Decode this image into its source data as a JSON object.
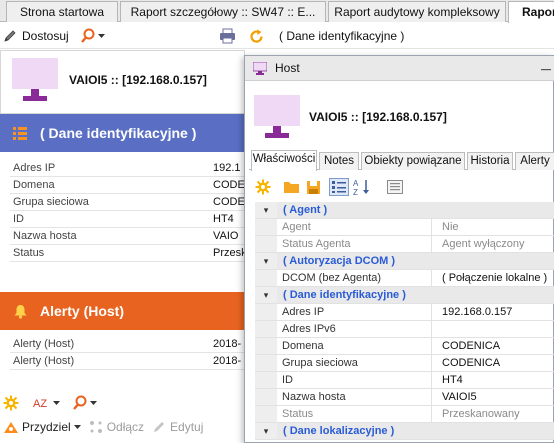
{
  "tabs": [
    {
      "label": "Strona startowa"
    },
    {
      "label": "Raport szczegółowy  ::  SW47 :: E..."
    },
    {
      "label": "Raport audytowy kompleksowy"
    },
    {
      "label": "Raport"
    }
  ],
  "toolbar": {
    "adjust_label": "Dostosuj",
    "section_label": "( Dane identyfikacyjne )"
  },
  "left": {
    "host_title": "VAIOI5 :: [192.168.0.157]",
    "identity_title": "( Dane identyfikacyjne )",
    "identity_rows": [
      {
        "key": "Adres IP",
        "value": "192.1"
      },
      {
        "key": "Domena",
        "value": "CODE"
      },
      {
        "key": "Grupa sieciowa",
        "value": "CODE"
      },
      {
        "key": "ID",
        "value": "HT4"
      },
      {
        "key": "Nazwa hosta",
        "value": "VAIO"
      },
      {
        "key": "Status",
        "value": "Przesk"
      }
    ],
    "alerts_title": "Alerty (Host)",
    "alert_rows": [
      {
        "key": "Alerty (Host)",
        "value": "2018-"
      },
      {
        "key": "Alerty (Host)",
        "value": "2018-"
      }
    ],
    "assign_label": "Przydziel",
    "detach_label": "Odłącz",
    "edit_label": "Edytuj"
  },
  "window": {
    "title": "Host",
    "host_title": "VAIOI5 :: [192.168.0.157]",
    "tabs": [
      {
        "label": "Właściwości"
      },
      {
        "label": "Notes"
      },
      {
        "label": "Obiekty powiązane"
      },
      {
        "label": "Historia"
      },
      {
        "label": "Alerty"
      }
    ],
    "rows": [
      {
        "type": "cat",
        "label": "( Agent )"
      },
      {
        "type": "prop",
        "dim": true,
        "key": "Agent",
        "value": "Nie"
      },
      {
        "type": "prop",
        "dim": true,
        "key": "Status Agenta",
        "value": "Agent wyłączony"
      },
      {
        "type": "cat",
        "label": "( Autoryzacja DCOM )"
      },
      {
        "type": "prop",
        "dim": false,
        "key": "DCOM (bez Agenta)",
        "value": "( Połączenie lokalne )"
      },
      {
        "type": "cat",
        "label": "( Dane identyfikacyjne )"
      },
      {
        "type": "prop",
        "dim": false,
        "key": "Adres IP",
        "value": "192.168.0.157"
      },
      {
        "type": "prop",
        "dim": false,
        "key": "Adres IPv6",
        "value": ""
      },
      {
        "type": "prop",
        "dim": false,
        "key": "Domena",
        "value": "CODENICA"
      },
      {
        "type": "prop",
        "dim": false,
        "key": "Grupa sieciowa",
        "value": "CODENICA"
      },
      {
        "type": "prop",
        "dim": false,
        "key": "ID",
        "value": "HT4"
      },
      {
        "type": "prop",
        "dim": false,
        "key": "Nazwa hosta",
        "value": "VAIOI5"
      },
      {
        "type": "prop",
        "dim": true,
        "key": "Status",
        "value": "Przeskanowany"
      },
      {
        "type": "cat",
        "label": "( Dane lokalizacyjne )"
      }
    ]
  },
  "colors": {
    "identity_bar": "#5a6fc4",
    "alerts_bar": "#e8631f",
    "category_text": "#2a5bd7"
  },
  "icons": [
    "pencil-icon",
    "search-icon",
    "printer-icon",
    "refresh-icon",
    "monitor-icon",
    "list-icon",
    "bell-icon",
    "settings-icon",
    "sort-az-icon",
    "folder-icon",
    "save-icon",
    "categorize-icon",
    "sort-icon",
    "pages-icon",
    "assign-icon",
    "detach-icon",
    "edit-icon",
    "minimize-icon",
    "expand-icon"
  ]
}
